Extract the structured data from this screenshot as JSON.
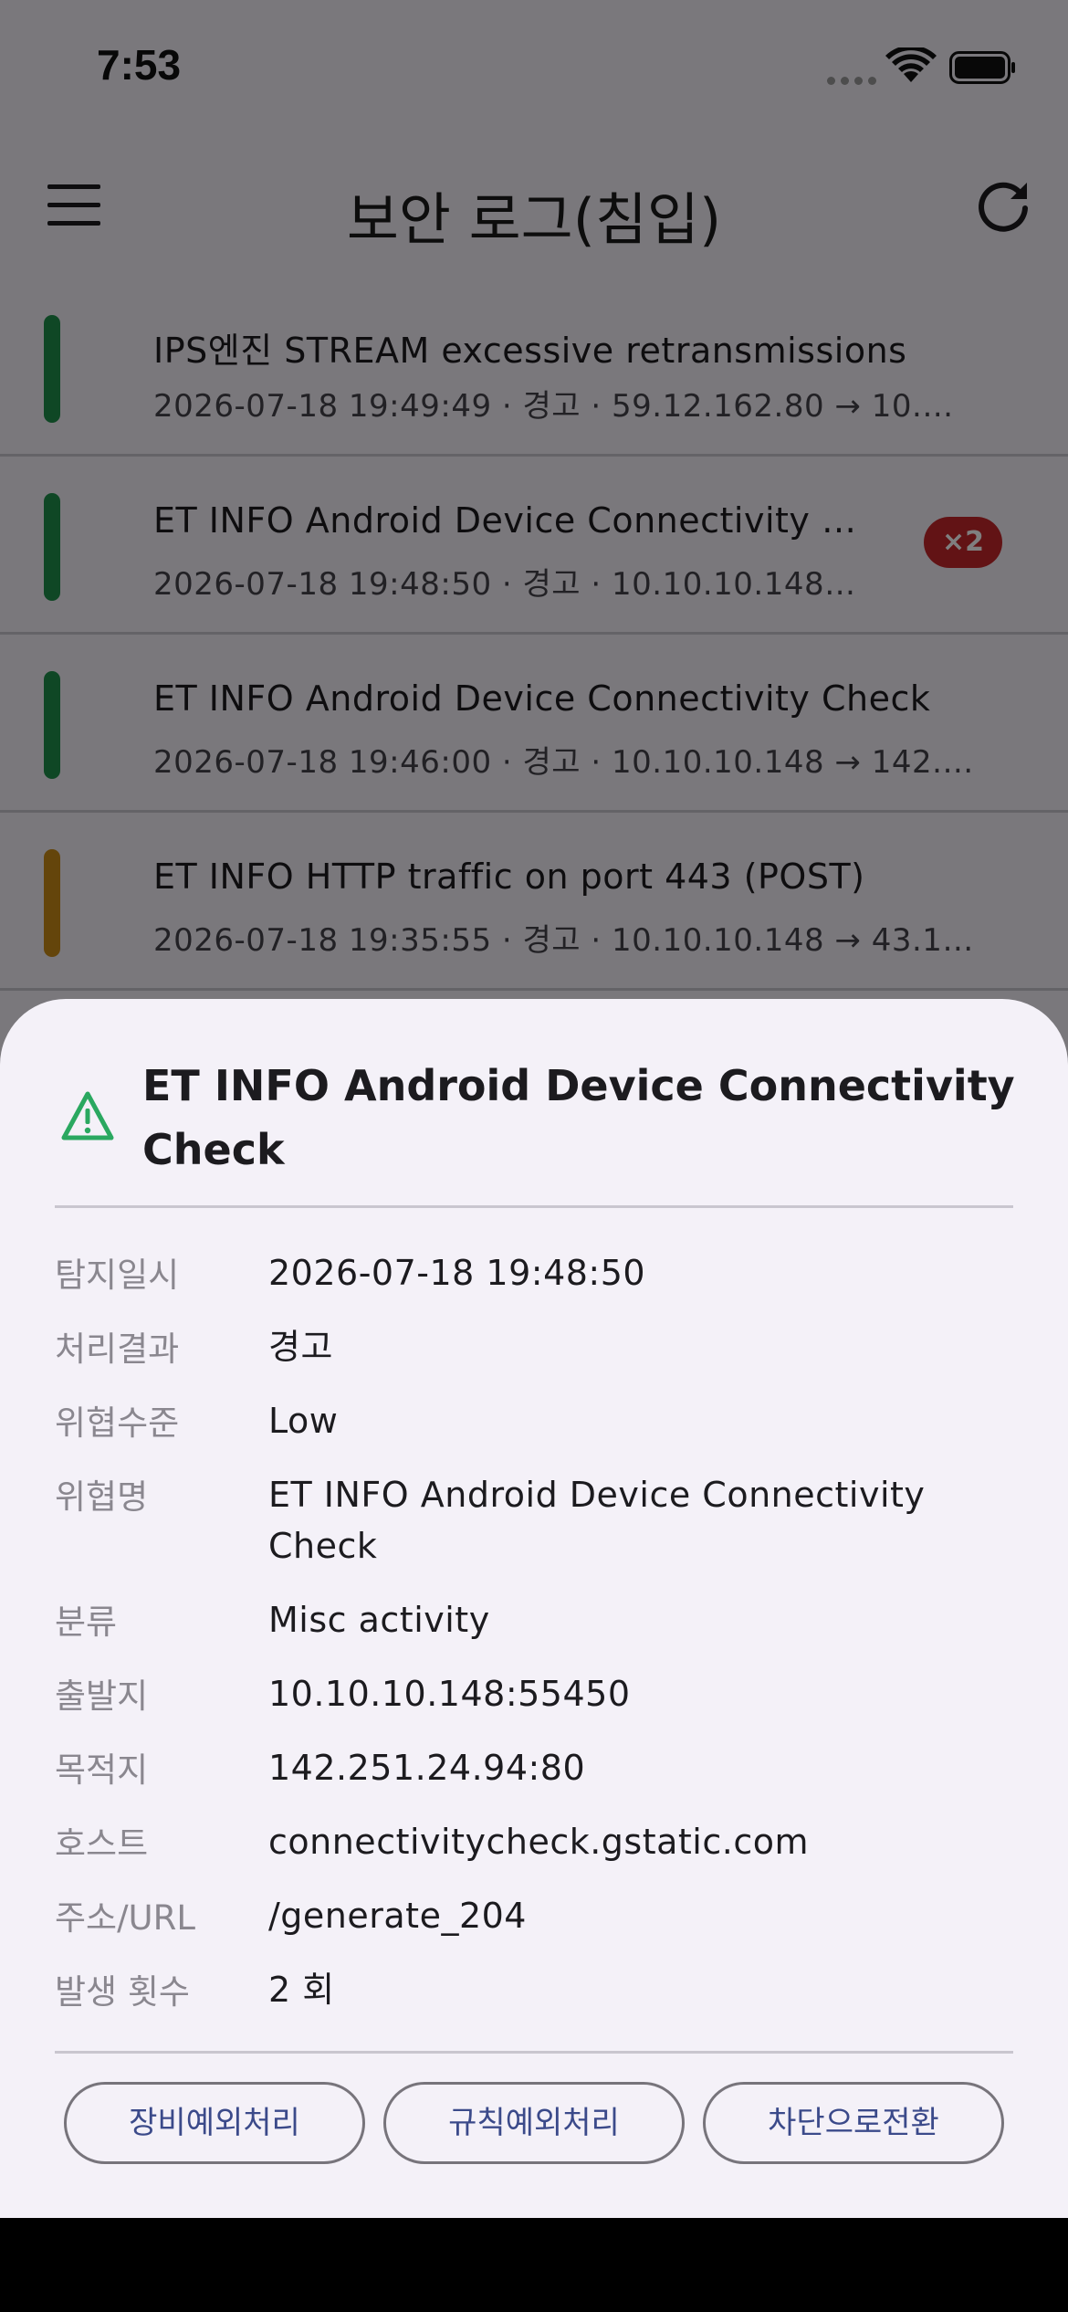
{
  "status_bar": {
    "time": "7:53"
  },
  "app_bar": {
    "title": "보안 로그(침입)"
  },
  "colors": {
    "green": "#1f8e4a",
    "orange": "#c98a16",
    "badge": "#c4272b",
    "accent": "#3b4a8a"
  },
  "logs": [
    {
      "title": "IPS엔진 STREAM excessive retransmissions",
      "meta": "2026-07-18 19:49:49  ·  경고  ·  59.12.162.80 → 10.…",
      "severity": "green",
      "badge": ""
    },
    {
      "title": "ET INFO Android Device Connectivity …",
      "meta": "2026-07-18 19:48:50  ·  경고  ·  10.10.10.148…",
      "severity": "green",
      "badge": "×2"
    },
    {
      "title": "ET INFO Android Device Connectivity Check",
      "meta": "2026-07-18 19:46:00  ·  경고  ·  10.10.10.148 → 142.…",
      "severity": "green",
      "badge": ""
    },
    {
      "title": "ET INFO HTTP traffic on port 443 (POST)",
      "meta": "2026-07-18 19:35:55  ·  경고  ·  10.10.10.148 → 43.1…",
      "severity": "orange",
      "badge": ""
    }
  ],
  "sheet": {
    "title": "ET INFO Android Device Connectivity Check",
    "details": [
      {
        "label": "탐지일시",
        "value": "2026-07-18 19:48:50"
      },
      {
        "label": "처리결과",
        "value": "경고"
      },
      {
        "label": "위협수준",
        "value": "Low"
      },
      {
        "label": "위협명",
        "value": "ET INFO Android Device Connectivity Check"
      },
      {
        "label": "분류",
        "value": "Misc activity"
      },
      {
        "label": "출발지",
        "value": "10.10.10.148:55450"
      },
      {
        "label": "목적지",
        "value": "142.251.24.94:80"
      },
      {
        "label": "호스트",
        "value": "connectivitycheck.gstatic.com"
      },
      {
        "label": "주소/URL",
        "value": "/generate_204"
      },
      {
        "label": "발생 횟수",
        "value": "2 회"
      }
    ],
    "actions": [
      "장비예외처리",
      "규칙예외처리",
      "차단으로전환"
    ]
  }
}
